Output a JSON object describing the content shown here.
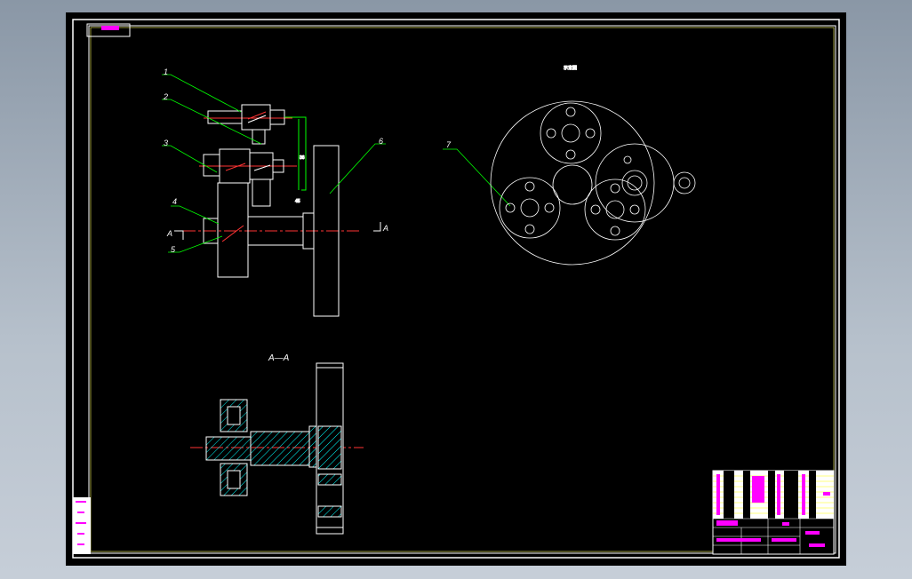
{
  "drawing": {
    "section_title": "A—A",
    "section_mark_left": "A",
    "section_mark_right": "A",
    "part_numbers": [
      "1",
      "2",
      "3",
      "4",
      "5",
      "6",
      "7"
    ],
    "top_view_caption": "示意图"
  },
  "colors": {
    "background": "#000000",
    "frame": "#ffffff",
    "frame_inner": "#ffff00",
    "leader": "#00ff00",
    "centerline": "#ff0000",
    "hatch": "#00ffff",
    "title_text": "#ff00ff"
  }
}
